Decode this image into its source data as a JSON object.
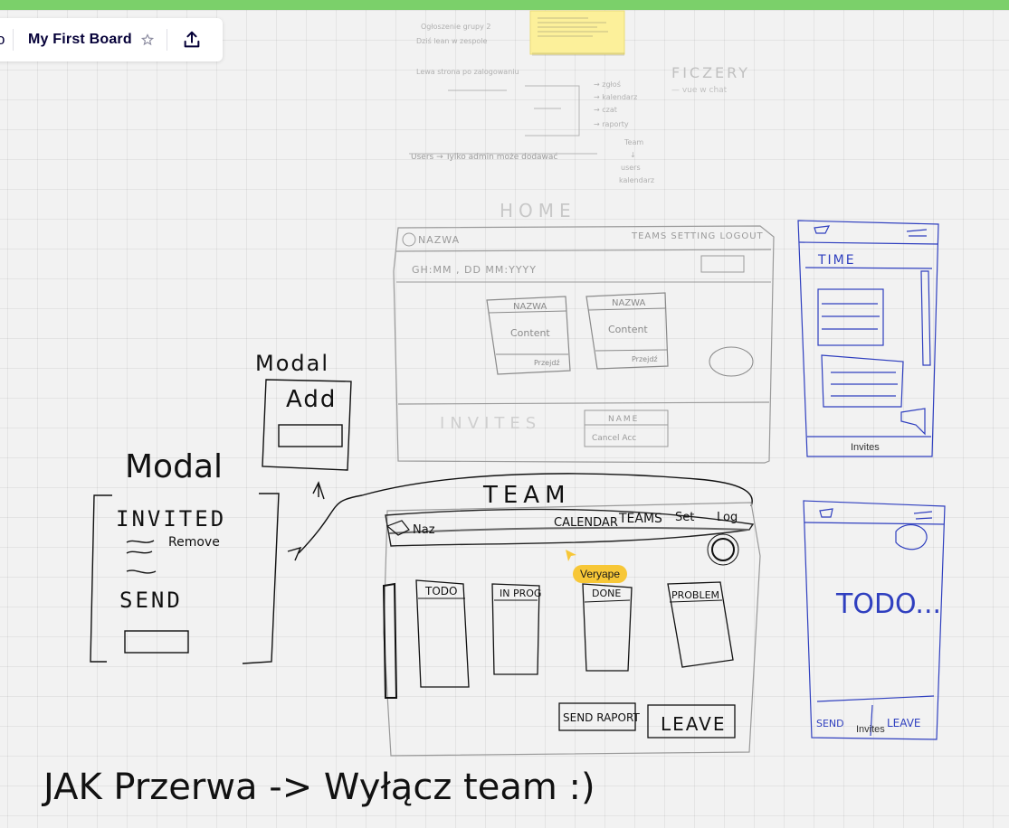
{
  "app": {
    "accent": "#7bd06a"
  },
  "toolbar": {
    "prev_glyph": "o",
    "board_title": "My First Board",
    "star_icon": "star-icon",
    "share_icon": "export-icon"
  },
  "sticky_note": {
    "color": "#fcf09a"
  },
  "sketch_notes": {
    "top_left_lines": [
      "Ogłoszenie grupy 2",
      "Dziś lean w zespole",
      "Users → Tylko admin może dodawać",
      "Lewa strona po zalogowaniu"
    ],
    "flow_right": [
      "→ zgłoś",
      "→ kalendarz",
      "→ czat",
      "→ raporty",
      "Team",
      "↓",
      "users",
      "kalendarz"
    ],
    "ficzery": "FICZERY",
    "ficzery_sub": "— vue w chat",
    "home_title": "HOME"
  },
  "home_sketch": {
    "logo": "NAZWA",
    "nav": "TEAMS  SETTING  LOGOUT",
    "date": "GH:MM , DD MM:YYYY",
    "card1_title": "NAZWA",
    "card1_content": "Content",
    "card1_footer": "Przejdź",
    "card2_title": "NAZWA",
    "card2_content": "Content",
    "card2_footer": "Przejdź",
    "invites": "INVITES",
    "name_box": "NAME",
    "name_box2": "Cancel  Acc"
  },
  "modal_add": {
    "title": "Modal",
    "label": "Add"
  },
  "modal_invited": {
    "title": "Modal",
    "heading": "INVITED",
    "remove": "Remove",
    "send": "SEND"
  },
  "team_sketch": {
    "title": "TEAM",
    "logo": "Naz",
    "nav_calendar": "CALENDAR",
    "nav_teams": "TEAMS",
    "nav_set": "Set",
    "nav_log": "Log",
    "col1": "TODO",
    "col2": "IN PROG",
    "col3": "DONE",
    "col4": "PROBLEM",
    "send_raport": "SEND RAPORT",
    "leave": "LEAVE"
  },
  "mobile_home": {
    "title": "TIME",
    "footer": "Invites"
  },
  "mobile_team": {
    "title": "TODO...",
    "footer_left": "SEND",
    "footer_mid": "Invites",
    "footer_right": "LEAVE"
  },
  "bottom_note": "JAK Przerwa -> Wyłącz team :)",
  "cursor": {
    "user": "Veryape",
    "color": "#f7c737"
  }
}
